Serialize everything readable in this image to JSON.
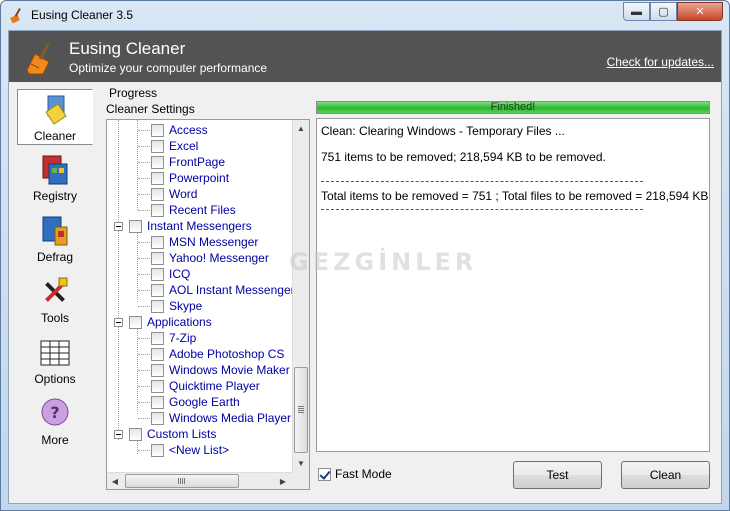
{
  "window": {
    "title": "Eusing Cleaner 3.5",
    "controls": {
      "minimize": "▬",
      "maximize": "▢",
      "close": "✕"
    }
  },
  "header": {
    "title": "Eusing Cleaner",
    "subtitle": "Optimize your computer performance",
    "update_link": "Check for updates..."
  },
  "sidebar": {
    "items": [
      {
        "label": "Cleaner",
        "icon": "broom-icon",
        "active": true
      },
      {
        "label": "Registry",
        "icon": "registry-icon",
        "active": false
      },
      {
        "label": "Defrag",
        "icon": "defrag-icon",
        "active": false
      },
      {
        "label": "Tools",
        "icon": "tools-icon",
        "active": false
      },
      {
        "label": "Options",
        "icon": "options-icon",
        "active": false
      },
      {
        "label": "More",
        "icon": "help-icon",
        "active": false
      }
    ]
  },
  "labels": {
    "progress": "Progress",
    "cleaner_settings": "Cleaner Settings"
  },
  "tree": {
    "items": [
      {
        "label": "Access",
        "level": 2,
        "checked": false
      },
      {
        "label": "Excel",
        "level": 2,
        "checked": false
      },
      {
        "label": "FrontPage",
        "level": 2,
        "checked": false
      },
      {
        "label": "Powerpoint",
        "level": 2,
        "checked": false
      },
      {
        "label": "Word",
        "level": 2,
        "checked": false
      },
      {
        "label": "Recent Files",
        "level": 2,
        "checked": false
      },
      {
        "label": "Instant Messengers",
        "level": 1,
        "checked": false
      },
      {
        "label": "MSN Messenger",
        "level": 2,
        "checked": false
      },
      {
        "label": "Yahoo! Messenger",
        "level": 2,
        "checked": false
      },
      {
        "label": "ICQ",
        "level": 2,
        "checked": false
      },
      {
        "label": "AOL Instant Messenger",
        "level": 2,
        "checked": false
      },
      {
        "label": "Skype",
        "level": 2,
        "checked": false
      },
      {
        "label": "Applications",
        "level": 1,
        "checked": false
      },
      {
        "label": "7-Zip",
        "level": 2,
        "checked": false
      },
      {
        "label": "Adobe Photoshop CS",
        "level": 2,
        "checked": false
      },
      {
        "label": "Windows Movie Maker",
        "level": 2,
        "checked": false
      },
      {
        "label": "Quicktime Player",
        "level": 2,
        "checked": false
      },
      {
        "label": "Google Earth",
        "level": 2,
        "checked": false
      },
      {
        "label": "Windows Media Player",
        "level": 2,
        "checked": false
      },
      {
        "label": "Custom Lists",
        "level": 1,
        "checked": false
      },
      {
        "label": "<New List>",
        "level": 2,
        "checked": false
      }
    ]
  },
  "progress": {
    "status": "Finished!",
    "percent": 100,
    "color": "#2fb52f"
  },
  "log": {
    "line1": "Clean: Clearing Windows - Temporary Files ...",
    "line2": "751 items to be removed; 218,594 KB to be removed.",
    "line3": "Total items to be removed = 751 ; Total files to be removed = 218,594 KB"
  },
  "watermark": "GEZGİNLER",
  "controls": {
    "fast_mode_label": "Fast Mode",
    "fast_mode_checked": true,
    "test_button": "Test",
    "clean_button": "Clean"
  }
}
